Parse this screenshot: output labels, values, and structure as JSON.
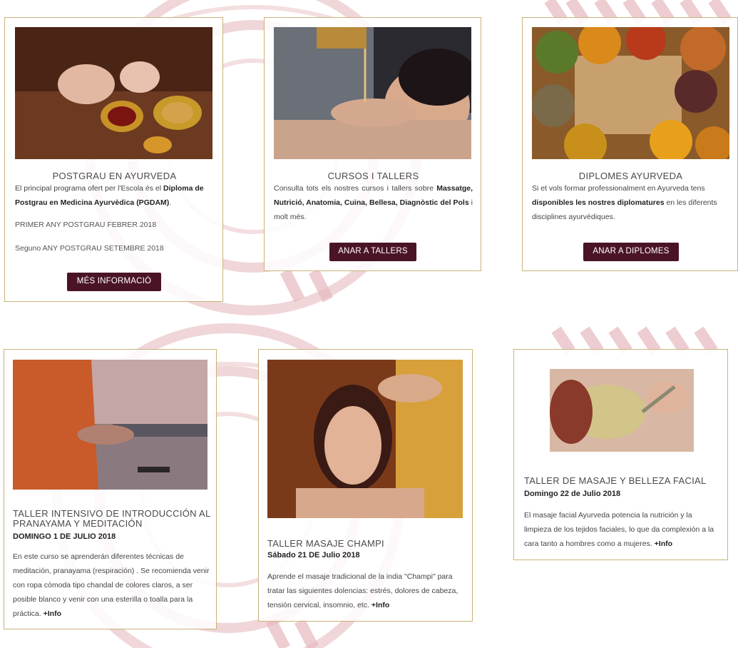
{
  "courses": [
    {
      "title": "POSTGRAU EN AYURVEDA",
      "intro_pre": "El principal programa ofert per l'Escola és el ",
      "intro_bold": "Diploma de Postgrau en Medicina Ayurvèdica (PGDAM)",
      "intro_post": ".",
      "line1": "PRIMER ANY POSTGRAU FEBRER 2018",
      "line2": "Seguno ANY POSTGRAU SETEMBRE 2018",
      "button": "MÉS INFORMACIÓ"
    },
    {
      "title": "CURSOS I TALLERS",
      "intro_pre": "Consulta tots els nostres cursos i tallers sobre ",
      "intro_bold": "Massatge, Nutrició, Anatomia, Cuina, Bellesa, Diagnòstic del Pols",
      "intro_post": " i molt més.",
      "button": "ANAR A TALLERS"
    },
    {
      "title": "DIPLOMES AYURVEDA",
      "intro_pre": "Si et vols formar professionalment en Ayurveda tens ",
      "intro_bold": "disponibles les nostres diplomatures",
      "intro_post": " en les diferents disciplines ayurvèdiques.",
      "button": "ANAR A DIPLOMES"
    }
  ],
  "workshops": [
    {
      "title": "TALLER INTENSIVO DE INTRODUCCIÓN AL PRANAYAMA Y MEDITACIÓN",
      "date": "DOMINGO 1 DE JULIO 2018",
      "desc": "En este curso se aprenderán diferentes técnicas de meditación, pranayama (respiración) .  Se recomienda venir con ropa cómoda tipo chandal de colores claros, a ser posible blanco y venir con una esterilla o toalla para la práctica. ",
      "more": "+Info"
    },
    {
      "title": "TALLER MASAJE CHAMPI",
      "date": "Sábado 21 DE Julio 2018",
      "desc": "Aprende el masaje tradicional de la india \"Champi\" para tratar las siguientes dolencias: estrés, dolores de cabeza, tensión cervical, insomnio, etc. ",
      "more": "+Info"
    },
    {
      "title": "TALLER DE MASAJE Y BELLEZA FACIAL",
      "date": "Domingo 22 de Julio 2018",
      "desc": "El masaje facial Ayurveda potencia la nutrición y la limpieza de los tejidos faciales, lo que da complexión a la cara tanto a hombres como a mujeres. ",
      "more": "+Info"
    }
  ],
  "colors": {
    "accent": "#4a1426",
    "border": "#c9b27a",
    "decor": "#e9c9cd"
  }
}
